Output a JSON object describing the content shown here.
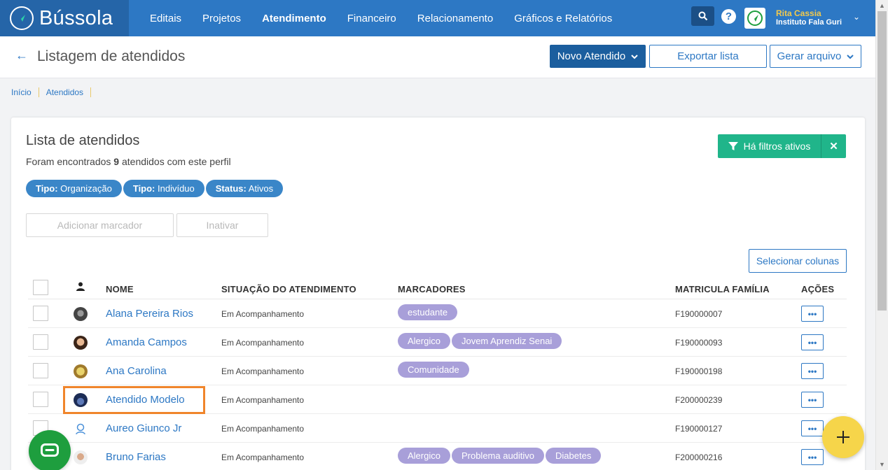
{
  "app": {
    "logo_text": "Bússola"
  },
  "nav": {
    "items": [
      {
        "label": "Editais",
        "active": false
      },
      {
        "label": "Projetos",
        "active": false
      },
      {
        "label": "Atendimento",
        "active": true
      },
      {
        "label": "Financeiro",
        "active": false
      },
      {
        "label": "Relacionamento",
        "active": false
      },
      {
        "label": "Gráficos e Relatórios",
        "active": false
      }
    ]
  },
  "user": {
    "name": "Rita Cassia",
    "organization": "Instituto Fala Guri"
  },
  "header": {
    "title": "Listagem de atendidos",
    "new_button": "Novo Atendido",
    "export_button": "Exportar lista",
    "generate_button": "Gerar arquivo"
  },
  "breadcrumb": [
    "Início",
    "Atendidos"
  ],
  "list": {
    "title": "Lista de atendidos",
    "subtitle_prefix": "Foram encontrados ",
    "count": "9",
    "subtitle_suffix": " atendidos com este perfil",
    "filters": [
      {
        "key": "Tipo:",
        "value": " Organização"
      },
      {
        "key": "Tipo:",
        "value": " Indivíduo"
      },
      {
        "key": "Status:",
        "value": " Ativos"
      }
    ],
    "filters_active_label": "Há filtros ativos",
    "add_marker_button": "Adicionar marcador",
    "deactivate_button": "Inativar",
    "select_columns_button": "Selecionar colunas"
  },
  "table": {
    "columns": [
      "NOME",
      "SITUAÇÃO DO ATENDIMENTO",
      "MARCADORES",
      "MATRICULA FAMÍLIA",
      "AÇÕES"
    ],
    "rows": [
      {
        "name": "Alana Pereira Rios",
        "status": "Em Acompanhamento",
        "markers": [
          "estudante"
        ],
        "matricula": "F190000007"
      },
      {
        "name": "Amanda Campos",
        "status": "Em Acompanhamento",
        "markers": [
          "Alergico",
          "Jovem Aprendiz Senai"
        ],
        "matricula": "F190000093"
      },
      {
        "name": "Ana Carolina",
        "status": "Em Acompanhamento",
        "markers": [
          "Comunidade"
        ],
        "matricula": "F190000198"
      },
      {
        "name": "Atendido Modelo",
        "status": "Em Acompanhamento",
        "markers": [],
        "matricula": "F200000239"
      },
      {
        "name": "Aureo Giunco Jr",
        "status": "Em Acompanhamento",
        "markers": [],
        "matricula": "F190000127"
      },
      {
        "name": "Bruno Farias",
        "status": "Em Acompanhamento",
        "markers": [
          "Alergico",
          "Problema auditivo",
          "Diabetes"
        ],
        "matricula": "F200000216"
      }
    ],
    "action_label": "•••"
  },
  "colors": {
    "primary": "#2d78c4",
    "nav": "#2d78c4",
    "success": "#20b58a",
    "marker": "#a89fd9",
    "highlight": "#f0852b",
    "fab_add": "#f6d54a",
    "fab_chat": "#1e9e3e"
  }
}
